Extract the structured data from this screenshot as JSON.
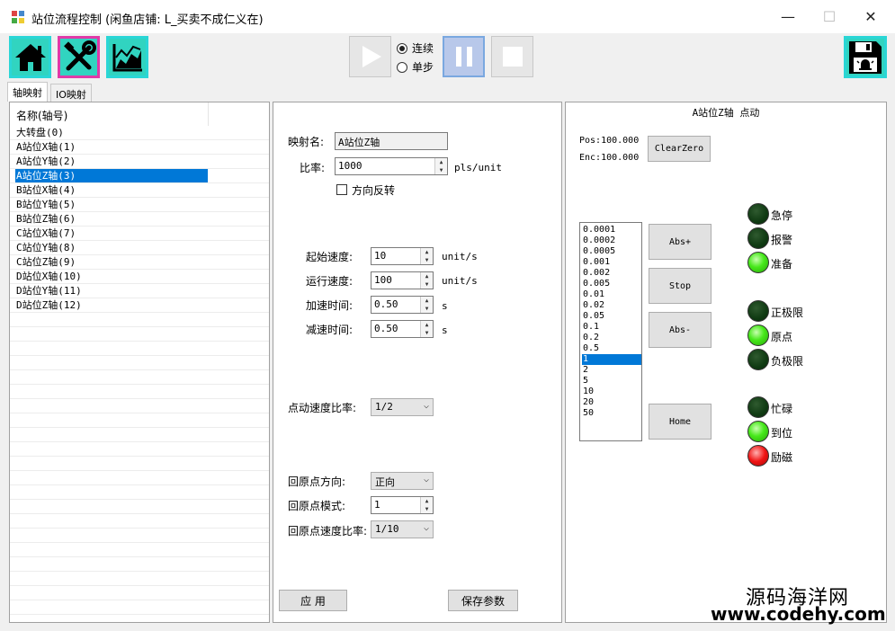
{
  "window": {
    "title": "站位流程控制 (闲鱼店铺: L_买卖不成仁义在)",
    "minimize": "—",
    "maximize": "☐",
    "close": "✕"
  },
  "toolbar": {
    "mode_continuous": "连续",
    "mode_single": "单步"
  },
  "tabs": [
    {
      "label": "轴映射"
    },
    {
      "label": "IO映射"
    }
  ],
  "axis_list": {
    "header": "名称(轴号)",
    "items": [
      "大转盘(0)",
      "A站位X轴(1)",
      "A站位Y轴(2)",
      "A站位Z轴(3)",
      "B站位X轴(4)",
      "B站位Y轴(5)",
      "B站位Z轴(6)",
      "C站位X轴(7)",
      "C站位Y轴(8)",
      "C站位Z轴(9)",
      "D站位X轴(10)",
      "D站位Y轴(11)",
      "D站位Z轴(12)"
    ],
    "selected_index": 3
  },
  "params": {
    "map_name_label": "映射名:",
    "map_name_value": "A站位Z轴",
    "ratio_label": "比率:",
    "ratio_value": "1000",
    "ratio_unit": "pls/unit",
    "reverse_label": "方向反转",
    "start_speed_label": "起始速度:",
    "start_speed_value": "10",
    "start_speed_unit": "unit/s",
    "run_speed_label": "运行速度:",
    "run_speed_value": "100",
    "run_speed_unit": "unit/s",
    "accel_label": "加速时间:",
    "accel_value": "0.50",
    "accel_unit": "s",
    "decel_label": "减速时间:",
    "decel_value": "0.50",
    "decel_unit": "s",
    "jog_ratio_label": "点动速度比率:",
    "jog_ratio_value": "1/2",
    "home_dir_label": "回原点方向:",
    "home_dir_value": "正向",
    "home_mode_label": "回原点模式:",
    "home_mode_value": "1",
    "home_speed_label": "回原点速度比率:",
    "home_speed_value": "1/10",
    "apply_label": "应 用",
    "save_label": "保存参数"
  },
  "jog": {
    "title": "A站位Z轴 点动",
    "pos": "Pos:100.000",
    "enc": "Enc:100.000",
    "clear_zero": "ClearZero",
    "steps": [
      "0.0001",
      "0.0002",
      "0.0005",
      "0.001",
      "0.002",
      "0.005",
      "0.01",
      "0.02",
      "0.05",
      "0.1",
      "0.2",
      "0.5",
      "1",
      "2",
      "5",
      "10",
      "20",
      "50"
    ],
    "selected_step": 12,
    "abs_plus": "Abs+",
    "stop": "Stop",
    "abs_minus": "Abs-",
    "home": "Home"
  },
  "status": {
    "estop": "急停",
    "alarm": "报警",
    "ready": "准备",
    "pos_limit": "正极限",
    "origin": "原点",
    "neg_limit": "负极限",
    "busy": "忙碌",
    "in_place": "到位",
    "excite": "励磁"
  },
  "watermark": {
    "line1": "源码海洋网",
    "line2": "www.codehy.com"
  }
}
